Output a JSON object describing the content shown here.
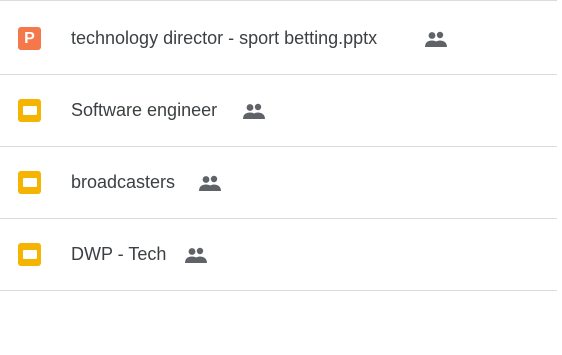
{
  "files": [
    {
      "name": "technology director - sport betting.pptx",
      "type": "pptx",
      "type_letter": "P",
      "shared": true,
      "icon": "people-icon"
    },
    {
      "name": "Software engineer",
      "type": "google-slides",
      "shared": true,
      "icon": "people-icon"
    },
    {
      "name": "broadcasters",
      "type": "google-slides",
      "shared": true,
      "icon": "people-icon"
    },
    {
      "name": "DWP - Tech",
      "type": "google-slides",
      "shared": true,
      "icon": "people-icon"
    }
  ],
  "colors": {
    "pptx": "#f4784a",
    "slides": "#f4b400",
    "text": "#3c4043",
    "shared_icon": "#5f6368",
    "divider": "#dadce0"
  }
}
